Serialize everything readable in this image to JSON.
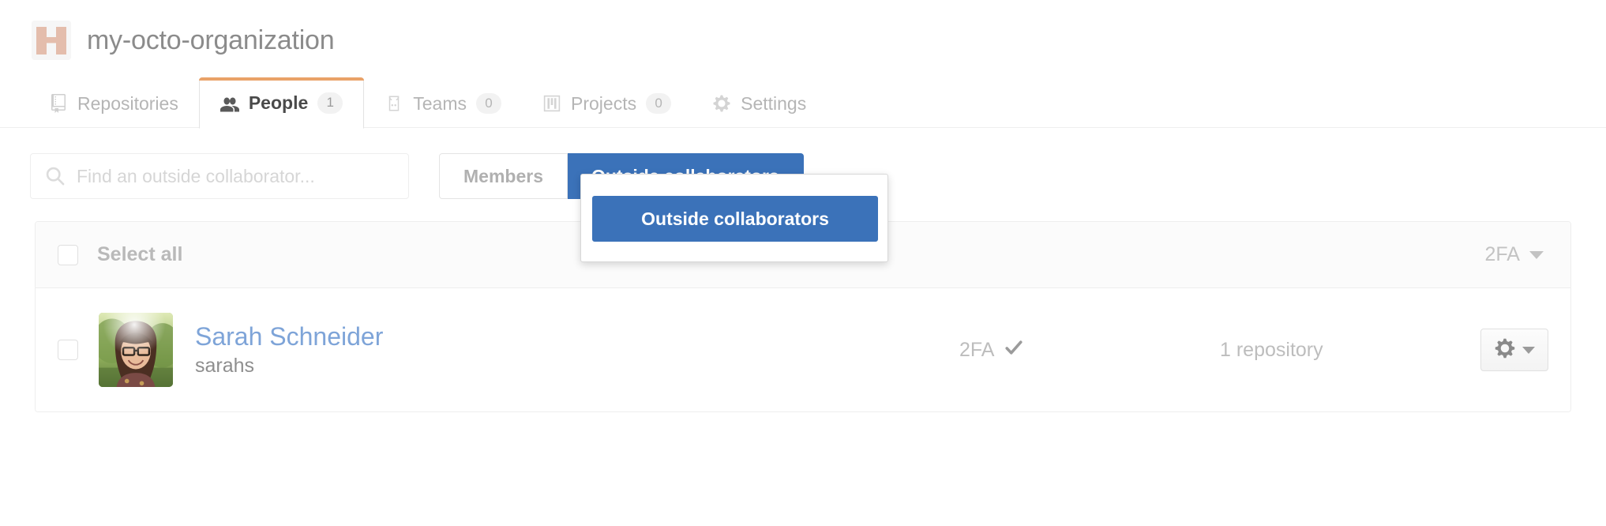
{
  "org": {
    "name": "my-octo-organization",
    "avatar_icon": "octo-h-logo-icon",
    "avatar_color": "#e4bdac",
    "avatar_bg": "#f6f6f6"
  },
  "tabs": [
    {
      "label": "Repositories",
      "icon": "repo-icon",
      "count": null,
      "active": false
    },
    {
      "label": "People",
      "icon": "people-icon",
      "count": "1",
      "active": true
    },
    {
      "label": "Teams",
      "icon": "jersey-icon",
      "count": "0",
      "active": false
    },
    {
      "label": "Projects",
      "icon": "project-board-icon",
      "count": "0",
      "active": false
    },
    {
      "label": "Settings",
      "icon": "gear-icon",
      "count": null,
      "active": false
    }
  ],
  "filters": {
    "search": {
      "placeholder": "Find an outside collaborator...",
      "value": "",
      "icon": "search-icon"
    },
    "segments": [
      {
        "label": "Members",
        "selected": false
      },
      {
        "label": "Outside collaborators",
        "selected": true
      }
    ],
    "highlight_target": "Outside collaborators"
  },
  "list": {
    "header": {
      "select_all_label": "Select all",
      "twofa_filter_label": "2FA",
      "twofa_filter_icon": "chevron-down-icon"
    },
    "rows": [
      {
        "name": "Sarah Schneider",
        "login": "sarahs",
        "twofa_label": "2FA",
        "twofa_state_icon": "check-icon",
        "repos_label": "1 repository",
        "avatar_alt": "sarahs-avatar",
        "actions_icon": "gear-icon",
        "actions_caret_icon": "chevron-down-icon"
      }
    ]
  },
  "colors": {
    "accent_tab": "#e9a268",
    "primary_button": "#3b72b9",
    "link": "#7ea4d8",
    "muted_text": "#bdbdbd"
  }
}
